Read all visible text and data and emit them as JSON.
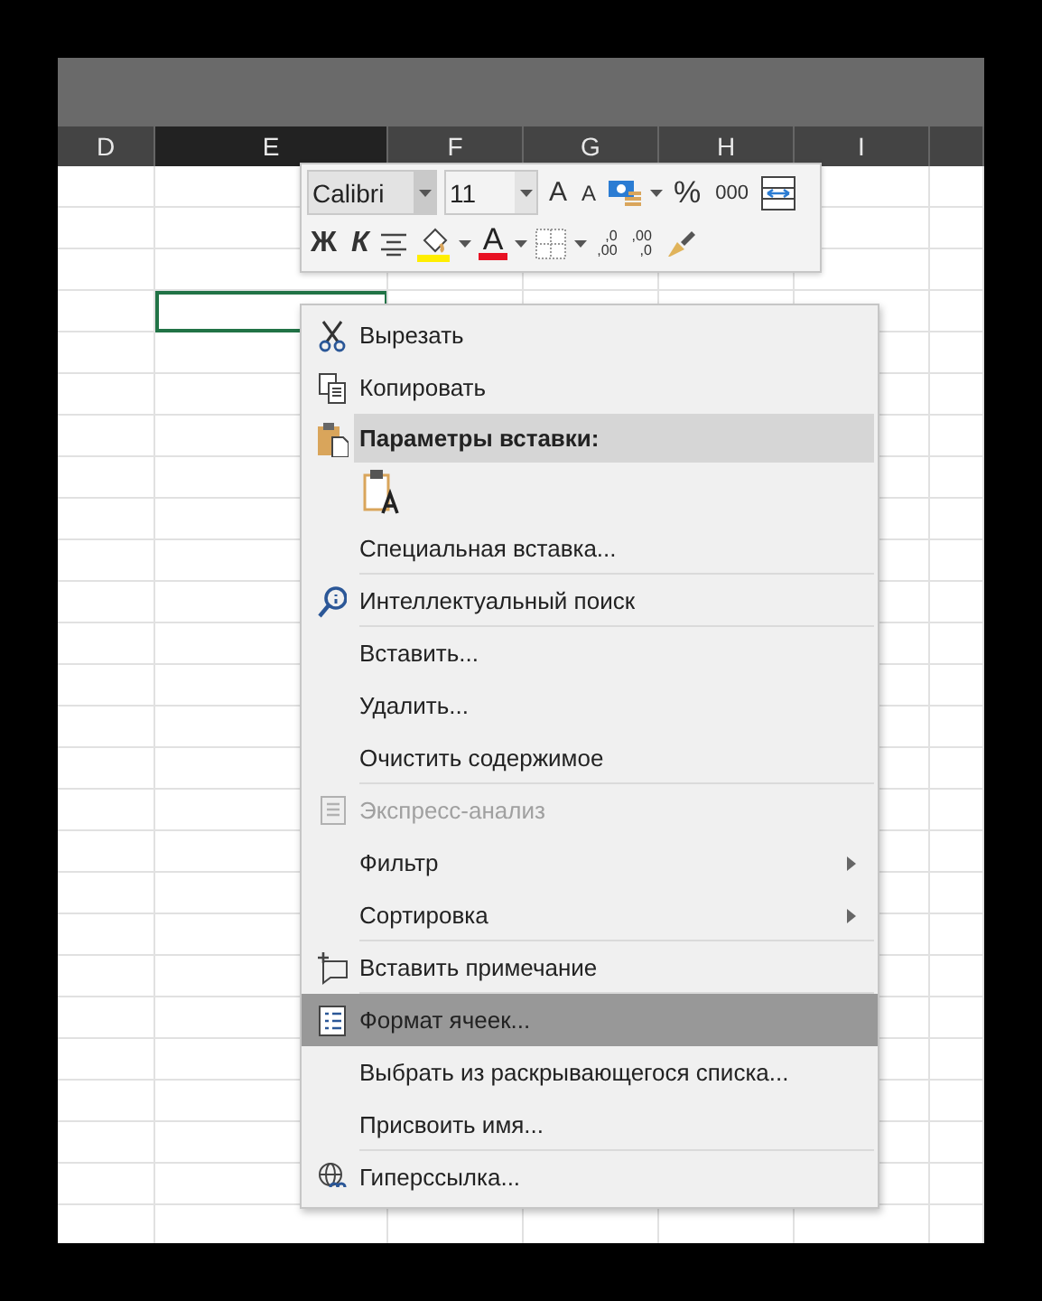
{
  "columns": [
    {
      "label": "D",
      "selected": false
    },
    {
      "label": "E",
      "selected": true
    },
    {
      "label": "F",
      "selected": false
    },
    {
      "label": "G",
      "selected": false
    },
    {
      "label": "H",
      "selected": false
    },
    {
      "label": "I",
      "selected": false
    },
    {
      "selected": false
    }
  ],
  "mini_toolbar": {
    "font": "Calibri",
    "size": "11",
    "grow_font": "A",
    "shrink_font": "A",
    "percent": "%",
    "thousands": "000",
    "bold": "Ж",
    "italic": "К",
    "font_color": "A",
    "increase_decimal": [
      ",0",
      ",00"
    ],
    "decrease_decimal": [
      ",00",
      ",0"
    ]
  },
  "menu": [
    {
      "kind": "item",
      "label": "Вырезать",
      "disabled": false,
      "submenu": false,
      "selected": false
    },
    {
      "kind": "item",
      "label": "Копировать",
      "disabled": false,
      "submenu": false,
      "selected": false
    },
    {
      "kind": "header",
      "label": "Параметры вставки:"
    },
    {
      "kind": "paste_options"
    },
    {
      "kind": "item",
      "label": "Специальная вставка...",
      "disabled": false,
      "submenu": false,
      "selected": false
    },
    {
      "kind": "separator"
    },
    {
      "kind": "item",
      "label": "Интеллектуальный поиск",
      "disabled": false,
      "submenu": false,
      "selected": false
    },
    {
      "kind": "separator"
    },
    {
      "kind": "item",
      "label": "Вставить...",
      "disabled": false,
      "submenu": false,
      "selected": false
    },
    {
      "kind": "item",
      "label": "Удалить...",
      "disabled": false,
      "submenu": false,
      "selected": false
    },
    {
      "kind": "item",
      "label": "Очистить содержимое",
      "disabled": false,
      "submenu": false,
      "selected": false
    },
    {
      "kind": "separator"
    },
    {
      "kind": "item",
      "label": "Экспресс-анализ",
      "disabled": true,
      "submenu": false,
      "selected": false
    },
    {
      "kind": "item",
      "label": "Фильтр",
      "disabled": false,
      "submenu": true,
      "selected": false
    },
    {
      "kind": "item",
      "label": "Сортировка",
      "disabled": false,
      "submenu": true,
      "selected": false
    },
    {
      "kind": "separator"
    },
    {
      "kind": "item",
      "label": "Вставить примечание",
      "disabled": false,
      "submenu": false,
      "selected": false
    },
    {
      "kind": "separator"
    },
    {
      "kind": "item",
      "label": "Формат ячеек...",
      "disabled": false,
      "submenu": false,
      "selected": true
    },
    {
      "kind": "item",
      "label": "Выбрать из раскрывающегося списка...",
      "disabled": false,
      "submenu": false,
      "selected": false
    },
    {
      "kind": "item",
      "label": "Присвоить имя...",
      "disabled": false,
      "submenu": false,
      "selected": false
    },
    {
      "kind": "separator"
    },
    {
      "kind": "item",
      "label": "Гиперссылка...",
      "disabled": false,
      "submenu": false,
      "selected": false
    }
  ]
}
